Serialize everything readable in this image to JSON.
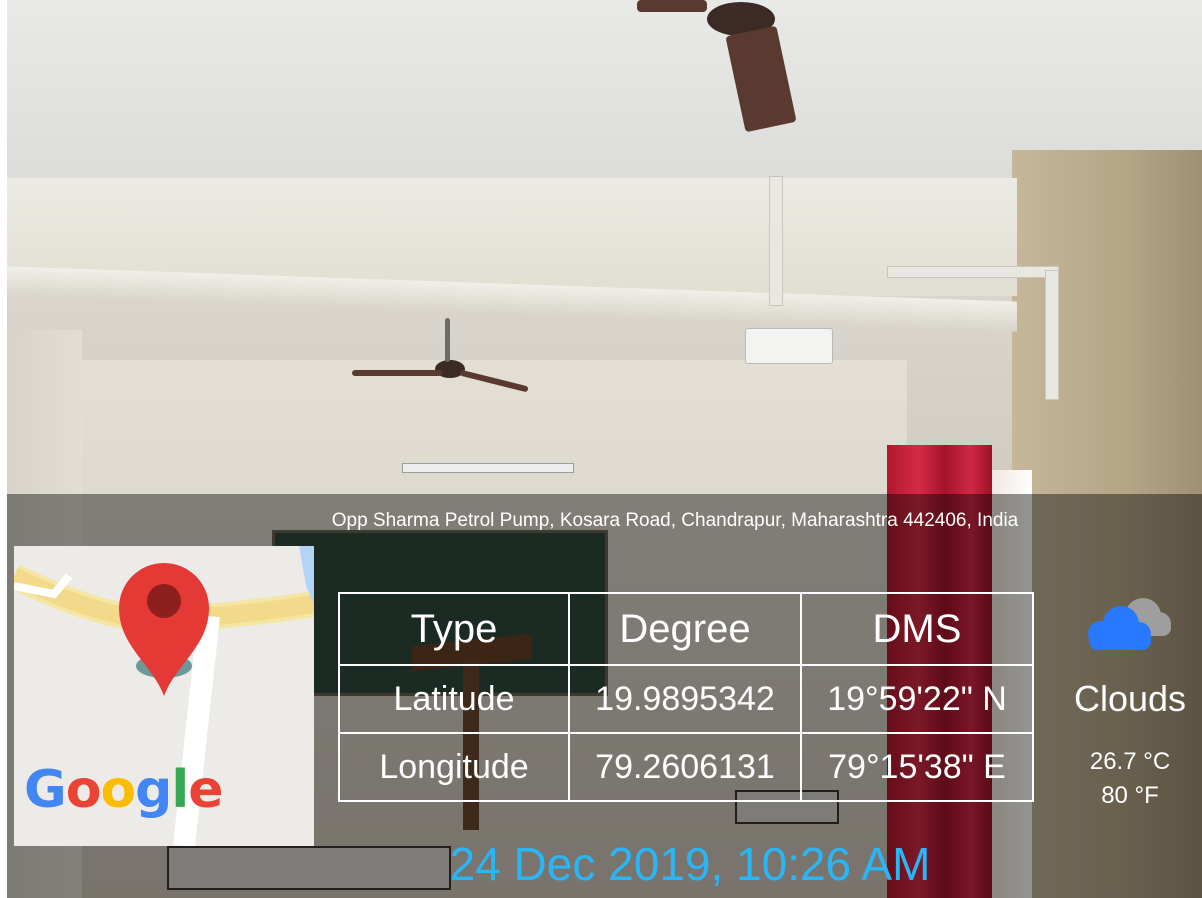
{
  "location": {
    "address": "Opp Sharma Petrol Pump, Kosara Road, Chandrapur, Maharashtra 442406, India"
  },
  "map": {
    "logo_text": "Google",
    "logo_colors": [
      "#4285F4",
      "#EA4335",
      "#FBBC05",
      "#4285F4",
      "#34A853",
      "#EA4335"
    ],
    "pin_color": "#E53935",
    "pin_icon": "map-pin-icon"
  },
  "coordinates": {
    "headers": [
      "Type",
      "Degree",
      "DMS"
    ],
    "rows": [
      {
        "type": "Latitude",
        "degree": "19.9895342",
        "dms": "19°59'22\" N"
      },
      {
        "type": "Longitude",
        "degree": "79.2606131",
        "dms": "79°15'38\" E"
      }
    ]
  },
  "weather": {
    "icon": "cloud-icon",
    "description": "Clouds",
    "temp_c": "26.7 °C",
    "temp_f": "80 °F"
  },
  "timestamp": "24 Dec 2019, 10:26 AM",
  "colors": {
    "timestamp": "#29B6F6",
    "cloud_front": "#2979FF",
    "cloud_back": "#9E9E9E"
  }
}
